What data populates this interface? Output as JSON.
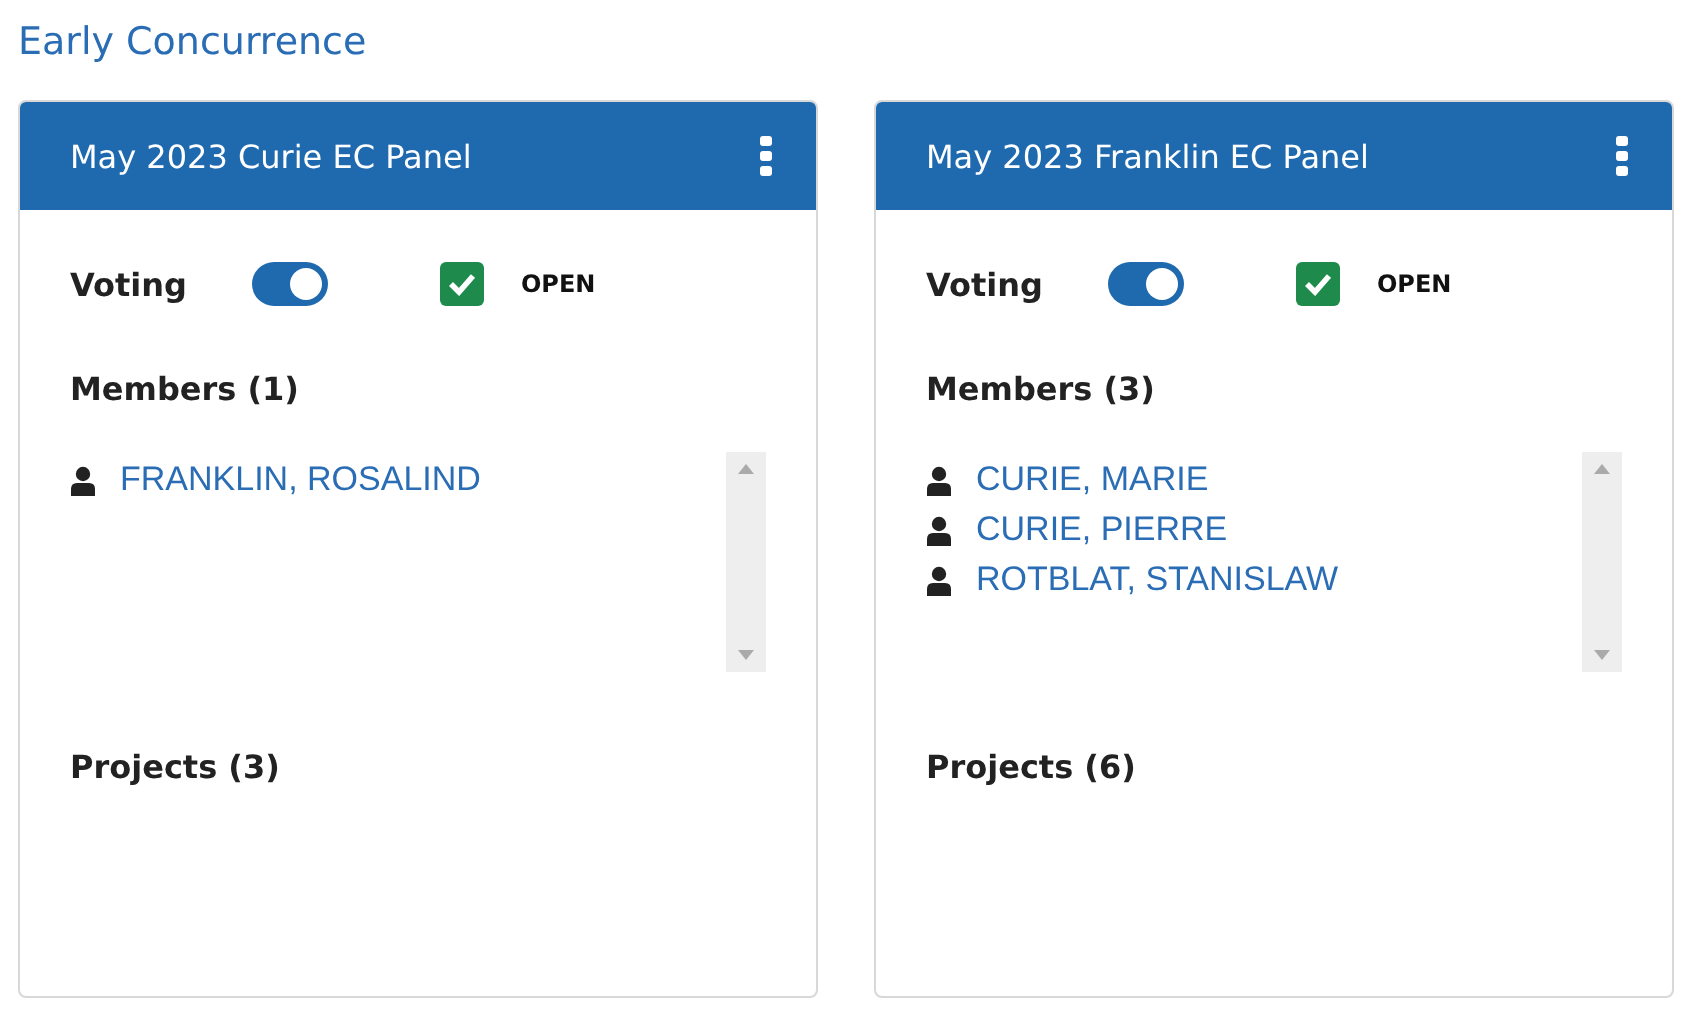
{
  "title": "Early Concurrence",
  "panels": [
    {
      "title": "May 2023 Curie EC Panel",
      "voting_label": "Voting",
      "voting_on": true,
      "open_checked": true,
      "open_label": "OPEN",
      "members_heading": "Members (1)",
      "members": [
        "FRANKLIN, ROSALIND"
      ],
      "projects_heading": "Projects (3)"
    },
    {
      "title": "May 2023 Franklin EC Panel",
      "voting_label": "Voting",
      "voting_on": true,
      "open_checked": true,
      "open_label": "OPEN",
      "members_heading": "Members (3)",
      "members": [
        "CURIE, MARIE",
        "CURIE, PIERRE",
        "ROTBLAT, STANISLAW"
      ],
      "projects_heading": "Projects (6)"
    }
  ]
}
